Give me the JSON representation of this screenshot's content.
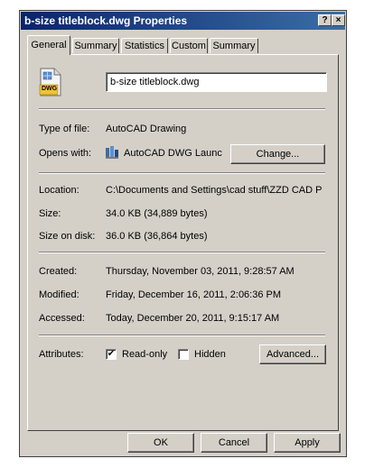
{
  "window": {
    "title": "b-size titleblock.dwg Properties",
    "help_glyph": "?",
    "close_glyph": "×"
  },
  "tabs": [
    {
      "label": "General",
      "active": true
    },
    {
      "label": "Summary"
    },
    {
      "label": "Statistics"
    },
    {
      "label": "Custom"
    },
    {
      "label": "Summary"
    }
  ],
  "general": {
    "file_icon": "dwg-file-icon",
    "file_icon_badge": "DWG",
    "file_name": "b-size titleblock.dwg",
    "type_label": "Type of file:",
    "type_value": "AutoCAD Drawing",
    "opens_label": "Opens with:",
    "opens_icon": "autocad-app-icon",
    "opens_value": "AutoCAD DWG Launc",
    "change_button": "Change...",
    "location_label": "Location:",
    "location_value": "C:\\Documents and Settings\\cad stuff\\ZZD CAD P",
    "size_label": "Size:",
    "size_value": "34.0 KB (34,889 bytes)",
    "size_on_disk_label": "Size on disk:",
    "size_on_disk_value": "36.0 KB (36,864 bytes)",
    "created_label": "Created:",
    "created_value": "Thursday, November 03, 2011, 9:28:57 AM",
    "modified_label": "Modified:",
    "modified_value": "Friday, December 16, 2011, 2:06:36 PM",
    "accessed_label": "Accessed:",
    "accessed_value": "Today, December 20, 2011, 9:15:17 AM",
    "attributes_label": "Attributes:",
    "readonly_label": "Read-only",
    "readonly_checked": true,
    "readonly_mark": "✔",
    "hidden_label": "Hidden",
    "hidden_checked": false,
    "advanced_button": "Advanced..."
  },
  "buttons": {
    "ok": "OK",
    "cancel": "Cancel",
    "apply": "Apply"
  },
  "colors": {
    "titlebar": "#0a246a",
    "dialog": "#d4d0c8"
  }
}
